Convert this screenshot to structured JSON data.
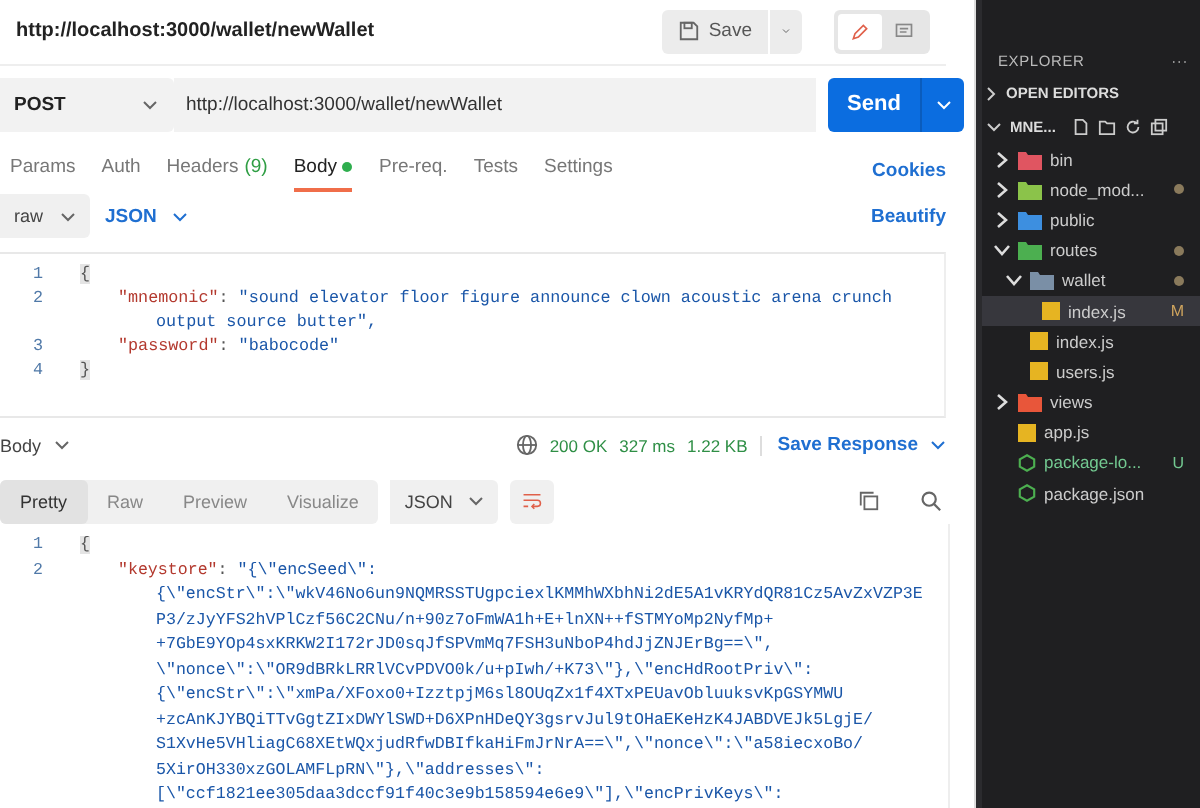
{
  "request": {
    "title": "http://localhost:3000/wallet/newWallet",
    "save_label": "Save",
    "mode_toggle": [
      {
        "kind": "edit",
        "selected": true
      },
      {
        "kind": "comment",
        "selected": false
      }
    ],
    "method": "POST",
    "url": "http://localhost:3000/wallet/newWallet",
    "send_label": "Send"
  },
  "tabs": [
    {
      "label": "Params",
      "dot": false,
      "selected": false
    },
    {
      "label": "Auth",
      "dot": false,
      "selected": false
    },
    {
      "label": "Headers",
      "count": "(9)",
      "dot": false,
      "selected": false
    },
    {
      "label": "Body",
      "dot": true,
      "selected": true
    },
    {
      "label": "Pre-req.",
      "dot": false,
      "selected": false
    },
    {
      "label": "Tests",
      "dot": false,
      "selected": false
    },
    {
      "label": "Settings",
      "dot": false,
      "selected": false
    }
  ],
  "cookies_link": "Cookies",
  "body_options": {
    "type": "raw",
    "format": "JSON",
    "beautify": "Beautify"
  },
  "request_body": [
    {
      "number": "1",
      "kind": "brace",
      "text": "{"
    },
    {
      "number": "2",
      "kind": "pair",
      "key": "\"mnemonic\"",
      "separator": ":",
      "value": "\"sound elevator floor figure announce clown acoustic arena crunch",
      "continuation": "output source butter\","
    },
    {
      "number": "3",
      "kind": "pair",
      "key": "\"password\"",
      "separator": ":",
      "value": "\"babocode\""
    },
    {
      "number": "4",
      "kind": "brace",
      "text": "}"
    }
  ],
  "response": {
    "label": "Body",
    "status": "200 OK",
    "time": "327 ms",
    "size": "1.22 KB",
    "save_response": "Save Response",
    "views": [
      {
        "label": "Pretty",
        "selected": true
      },
      {
        "label": "Raw",
        "selected": false
      },
      {
        "label": "Preview",
        "selected": false
      },
      {
        "label": "Visualize",
        "selected": false
      }
    ],
    "format": "JSON",
    "lines": [
      {
        "number": "1",
        "kind": "brace",
        "text": "{"
      },
      {
        "number": "2",
        "kind": "pair",
        "key": "\"keystore\"",
        "separator": ":",
        "value": "\"{\\\"encSeed\\\":"
      },
      {
        "kind": "wrap",
        "text": "{\\\"encStr\\\":\\\"wkV46No6un9NQMRSSTUgpciexlKMMhWXbhNi2dE5A1vKRYdQR81Cz5AvZxVZP3E"
      },
      {
        "kind": "wrap",
        "text": "P3/zJyYFS2hVPlCzf56C2CNu/n+90z7oFmWA1h+E+lnXN++fSTMYoMp2NyfMp+"
      },
      {
        "kind": "wrap",
        "text": "+7GbE9YOp4sxKRKW2I172rJD0sqJfSPVmMq7FSH3uNboP4hdJjZNJErBg==\\\","
      },
      {
        "kind": "wrap",
        "text": "\\\"nonce\\\":\\\"OR9dBRkLRRlVCvPDVO0k/u+pIwh/+K73\\\"},\\\"encHdRootPriv\\\":"
      },
      {
        "kind": "wrap",
        "text": "{\\\"encStr\\\":\\\"xmPa/XFoxo0+IzztpjM6sl8OUqZx1f4XTxPEUavObluuksvKpGSYMWU"
      },
      {
        "kind": "wrap",
        "text": "+zcAnKJYBQiTTvGgtZIxDWYlSWD+D6XPnHDeQY3gsrvJul9tOHaEKeHzK4JABDVEJk5LgjE/"
      },
      {
        "kind": "wrap",
        "text": "S1XvHe5VHliagC68XEtWQxjudRfwDBIfkaHiFmJrNrA==\\\",\\\"nonce\\\":\\\"a58iecxoBo/"
      },
      {
        "kind": "wrap",
        "text": "5XirOH330xzGOLAMFLpRN\\\"},\\\"addresses\\\":"
      },
      {
        "kind": "wrap",
        "text": "[\\\"ccf1821ee305daa3dccf91f40c3e9b158594e6e9\\\"],\\\"encPrivKeys\\\":"
      }
    ]
  },
  "explorer": {
    "title": "EXPLORER",
    "more": "···",
    "open_editors": "OPEN EDITORS",
    "project": "MNE...",
    "tree": [
      {
        "label": "bin",
        "kind": "folder",
        "color": "#e05561",
        "expanded": false,
        "dot": false,
        "selected": false
      },
      {
        "label": "node_mod...",
        "kind": "folder",
        "color": "#8bc34a",
        "expanded": false,
        "dot": true,
        "selected": false
      },
      {
        "label": "public",
        "kind": "folder",
        "color": "#3d8fe0",
        "expanded": false,
        "dot": false,
        "selected": false
      },
      {
        "label": "routes",
        "kind": "folder",
        "color": "#4caf50",
        "expanded": true,
        "dot": true,
        "selected": false,
        "children": [
          {
            "label": "wallet",
            "kind": "folder",
            "color": "#7a8fa6",
            "expanded": true,
            "dot": true,
            "selected": false,
            "children": [
              {
                "label": "index.js",
                "kind": "js",
                "color": "#e6b422",
                "badge": "M",
                "selected": true
              }
            ]
          },
          {
            "label": "index.js",
            "kind": "js",
            "color": "#e6b422",
            "selected": false
          },
          {
            "label": "users.js",
            "kind": "js",
            "color": "#e6b422",
            "selected": false
          }
        ]
      },
      {
        "label": "views",
        "kind": "folder",
        "color": "#e8563a",
        "expanded": false,
        "dot": false,
        "selected": false
      },
      {
        "label": "app.js",
        "kind": "js",
        "color": "#e6b422",
        "selected": false
      },
      {
        "label": "package-lo...",
        "kind": "json",
        "color": "#4caf50",
        "badge": "U",
        "selected": false
      },
      {
        "label": "package.json",
        "kind": "json",
        "color": "#4caf50",
        "selected": false
      }
    ]
  }
}
